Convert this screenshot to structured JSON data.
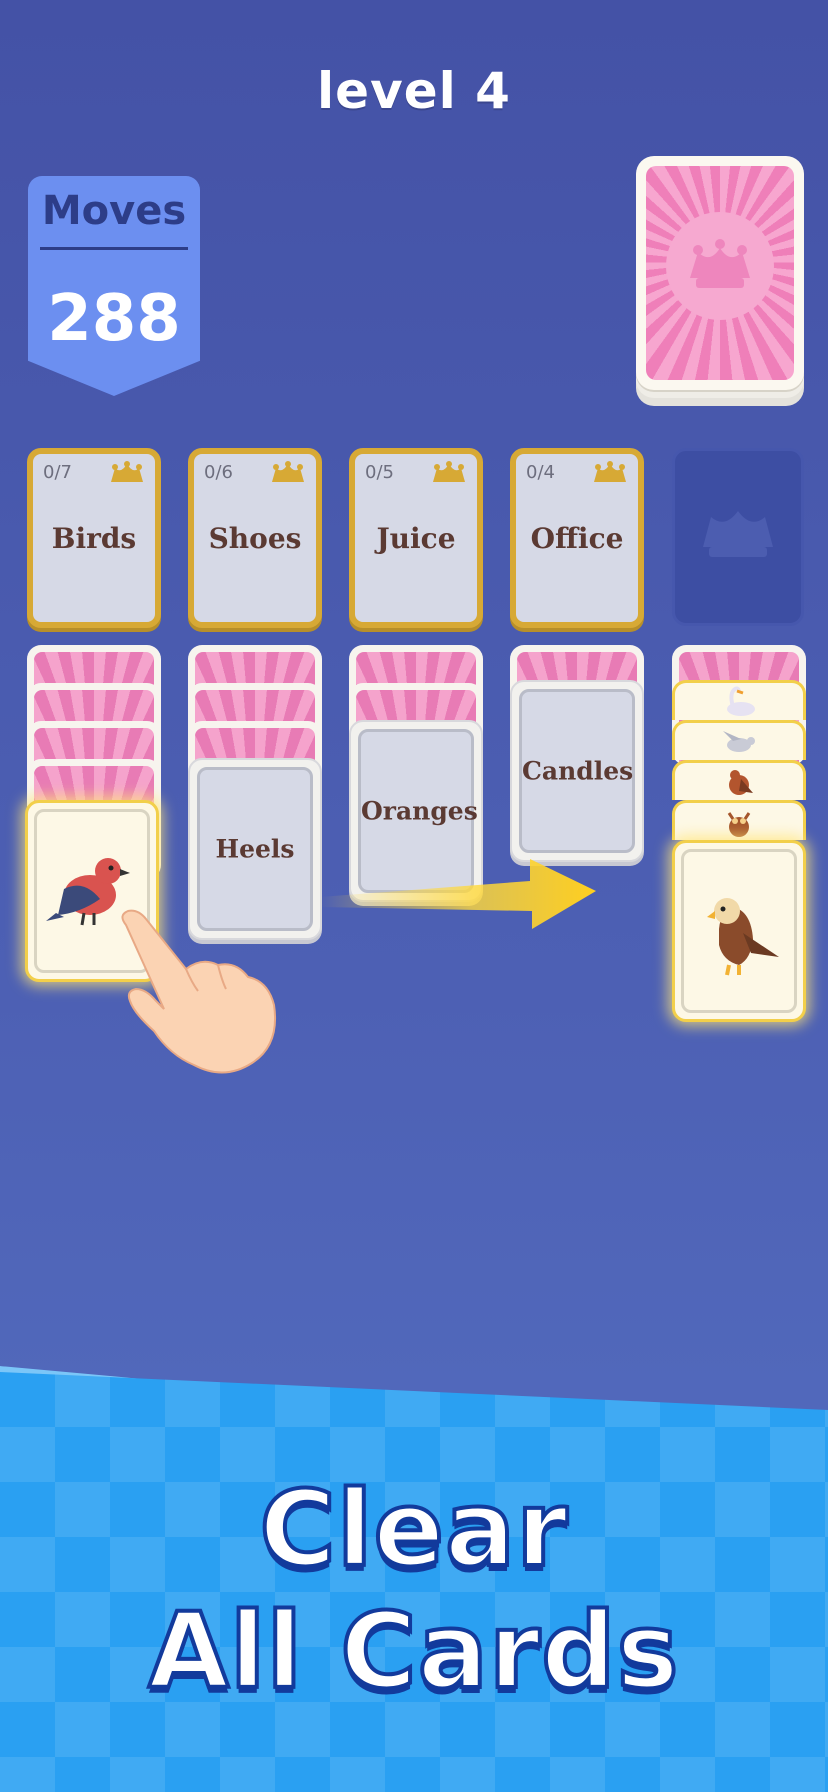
{
  "level_title": "level 4",
  "moves": {
    "label": "Moves",
    "value": "288"
  },
  "foundations": [
    {
      "count": "0/7",
      "name": "Birds"
    },
    {
      "count": "0/6",
      "name": "Shoes"
    },
    {
      "count": "0/5",
      "name": "Juice"
    },
    {
      "count": "0/4",
      "name": "Office"
    }
  ],
  "tableau": {
    "col1_top_card_icon": "robin-bird-icon",
    "col2_top_card": "Heels",
    "col3_top_card": "Oranges",
    "col4_top_card": "Candles",
    "col5_icons": [
      "swan-icon",
      "dove-icon",
      "hawk-icon",
      "owl-icon",
      "eagle-icon"
    ]
  },
  "tutorial": {
    "hand": "pointing-hand-icon",
    "arrow": "arrow-right-icon"
  },
  "banner": {
    "line1": "Clear",
    "line2": "All Cards"
  },
  "colors": {
    "background": "#4452a6",
    "foundation_border": "#d7a935",
    "banner": "#2aa0f2",
    "card_back": "#ef7fb9"
  }
}
